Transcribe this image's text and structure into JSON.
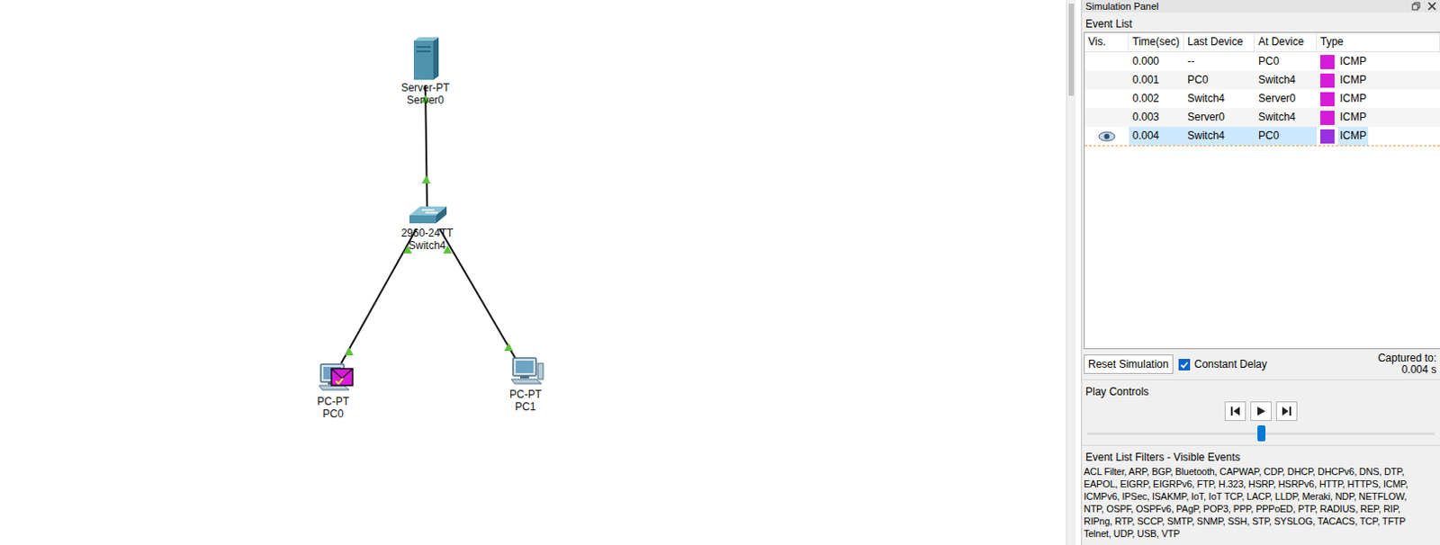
{
  "canvas": {
    "devices": [
      {
        "kind": "server",
        "model": "Server-PT",
        "name": "Server0"
      },
      {
        "kind": "switch",
        "model": "2960-24TT",
        "name": "Switch4"
      },
      {
        "kind": "pc",
        "model": "PC-PT",
        "name": "PC0"
      },
      {
        "kind": "pc",
        "model": "PC-PT",
        "name": "PC1"
      }
    ],
    "links": [
      {
        "from": "Server0",
        "to": "Switch4",
        "up": true
      },
      {
        "from": "Switch4",
        "to": "PC0",
        "up": true
      },
      {
        "from": "Switch4",
        "to": "PC1",
        "up": true
      }
    ],
    "pdu": {
      "at": "PC0",
      "color": "#d81bd8"
    }
  },
  "panel": {
    "title": "Simulation Panel",
    "event_list": {
      "label": "Event List",
      "columns": [
        "Vis.",
        "Time(sec)",
        "Last Device",
        "At Device",
        "Type"
      ],
      "rows": [
        {
          "time": "0.000",
          "last": "--",
          "at": "PC0",
          "type": "ICMP",
          "color": "#d81bd8",
          "visible": false,
          "selected": false
        },
        {
          "time": "0.001",
          "last": "PC0",
          "at": "Switch4",
          "type": "ICMP",
          "color": "#d81bd8",
          "visible": false,
          "selected": false
        },
        {
          "time": "0.002",
          "last": "Switch4",
          "at": "Server0",
          "type": "ICMP",
          "color": "#d81bd8",
          "visible": false,
          "selected": false
        },
        {
          "time": "0.003",
          "last": "Server0",
          "at": "Switch4",
          "type": "ICMP",
          "color": "#d81bd8",
          "visible": false,
          "selected": false
        },
        {
          "time": "0.004",
          "last": "Switch4",
          "at": "PC0",
          "type": "ICMP",
          "color": "#9b30e0",
          "visible": true,
          "selected": true
        }
      ]
    },
    "reset_button": "Reset Simulation",
    "constant_delay": {
      "label": "Constant Delay",
      "checked": true
    },
    "captured": {
      "label": "Captured to:",
      "value": "0.004 s"
    },
    "play_controls": {
      "label": "Play Controls",
      "level": 0.5
    },
    "filters": {
      "label": "Event List Filters - Visible Events",
      "lines": [
        "ACL Filter, ARP, BGP, Bluetooth, CAPWAP, CDP, DHCP, DHCPv6, DNS, DTP,",
        "EAPOL, EIGRP, EIGRPv6, FTP, H.323, HSRP, HSRPv6, HTTP, HTTPS, ICMP,",
        "ICMPv6, IPSec, ISAKMP, IoT, IoT TCP, LACP, LLDP, Meraki, NDP, NETFLOW,",
        "NTP, OSPF, OSPFv6, PAgP, POP3, PPP, PPPoED, PTP, RADIUS, REP, RIP,",
        "RIPng, RTP, SCCP, SMTP, SNMP, SSH, STP, SYSLOG, TACACS, TCP, TFTP",
        "Telnet, UDP, USB, VTP"
      ]
    }
  }
}
